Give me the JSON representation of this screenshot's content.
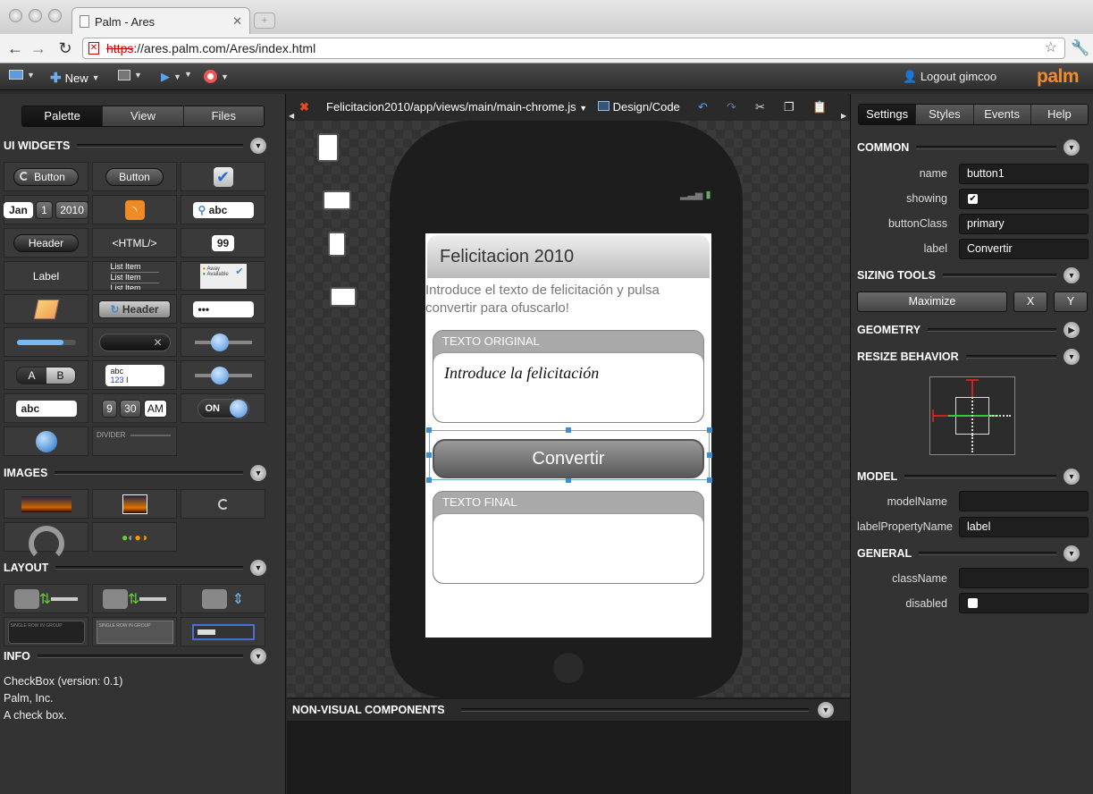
{
  "browser": {
    "tab_title": "Palm - Ares",
    "url_scheme": "https",
    "url_rest": "://ares.palm.com/Ares/index.html"
  },
  "topbar": {
    "new_label": "New",
    "logout_label": "Logout gimcoo",
    "brand": "palm"
  },
  "left": {
    "tabs": [
      "Palette",
      "View",
      "Files"
    ],
    "sections": {
      "widgets": "UI WIDGETS",
      "images": "IMAGES",
      "layout": "LAYOUT",
      "info": "INFO"
    },
    "widgets": {
      "button1": "Button",
      "button2": "Button",
      "date_month": "Jan",
      "date_day": "1",
      "date_year": "2010",
      "search": "abc",
      "header": "Header",
      "html": "<HTML/>",
      "num": "99",
      "label": "Label",
      "list_item": "List Item",
      "list_away": "Away",
      "list_avail": "Available",
      "header2": "Header",
      "password": "•••",
      "radio_a": "A",
      "radio_b": "B",
      "rich_abc": "abc",
      "rich_123": "123",
      "textfield": "abc",
      "time_h": "9",
      "time_m": "30",
      "time_ampm": "AM",
      "toggle": "ON",
      "divider": "DIVIDER",
      "row_label": "SINGLE ROW IN GROUP"
    },
    "info": {
      "line1": "CheckBox (version: 0.1)",
      "line2": "Palm, Inc.",
      "line3": "A check box."
    }
  },
  "center": {
    "file_path": "Felicitacion2010/app/views/main/main-chrome.js",
    "mode": "Design/Code",
    "screen_title": "Felicitacion 2010",
    "intro": "Introduce el texto de felicitación y pulsa convertir para ofuscarlo!",
    "group1_title": "TEXTO ORIGINAL",
    "group1_text": "Introduce la felicitación",
    "button_label": "Convertir",
    "group2_title": "TEXTO FINAL",
    "nonvisual": "NON-VISUAL COMPONENTS"
  },
  "right": {
    "tabs": [
      "Settings",
      "Styles",
      "Events",
      "Help"
    ],
    "common": "COMMON",
    "props": {
      "name_label": "name",
      "name_value": "button1",
      "showing_label": "showing",
      "buttonClass_label": "buttonClass",
      "buttonClass_value": "primary",
      "label_label": "label",
      "label_value": "Convertir"
    },
    "sizing": "SIZING TOOLS",
    "maximize": "Maximize",
    "x": "X",
    "y": "Y",
    "geometry": "GEOMETRY",
    "resize": "RESIZE BEHAVIOR",
    "model": "MODEL",
    "modelName_label": "modelName",
    "labelPropertyName_label": "labelPropertyName",
    "labelPropertyName_value": "label",
    "general": "GENERAL",
    "className_label": "className",
    "disabled_label": "disabled"
  },
  "colors": {
    "accent": "#f28c28",
    "selection": "#3a8fd6"
  }
}
